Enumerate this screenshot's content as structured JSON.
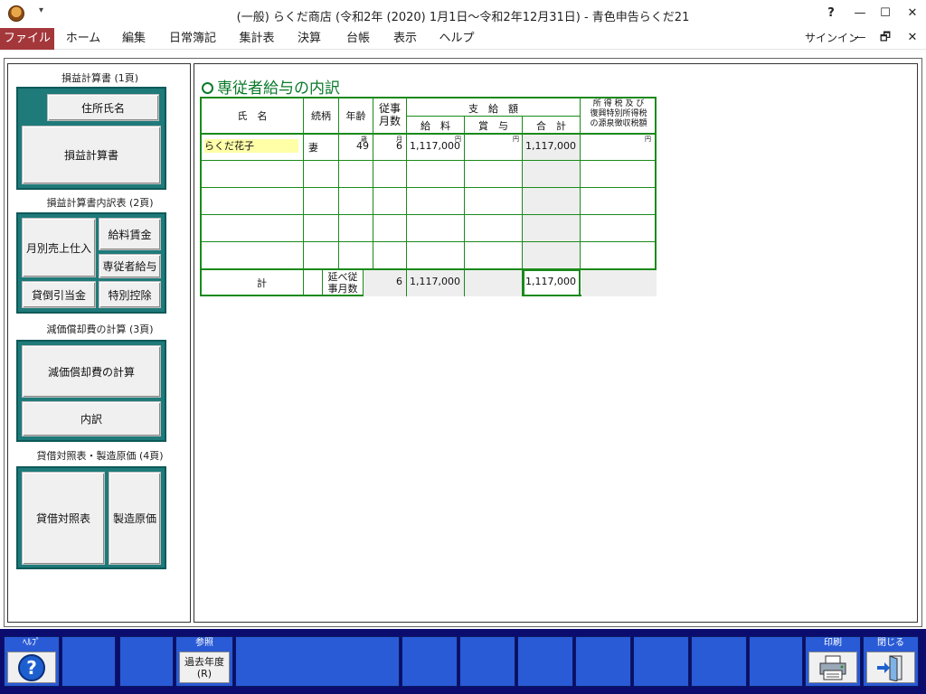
{
  "window": {
    "title": "(一般) らくだ商店 (令和2年 (2020) 1月1日～令和2年12月31日) - 青色申告らくだ21",
    "qat_glyph": "▾",
    "help_glyph": "?",
    "min_glyph": "—",
    "max_glyph": "☐",
    "close_glyph": "✕"
  },
  "ribbon": {
    "tabs": [
      "ファイル",
      "ホーム",
      "編集",
      "日常簿記",
      "集計表",
      "決算",
      "台帳",
      "表示",
      "ヘルプ"
    ],
    "active_tab": "ファイル",
    "signin": "サインイン",
    "restore_glyph": "🗗"
  },
  "nav": {
    "sections": [
      {
        "label": "損益計算書 (1頁)",
        "buttons": [
          "住所氏名",
          "損益計算書"
        ]
      },
      {
        "label": "損益計算書内訳表 (2頁)",
        "buttons": [
          "月別売上仕入",
          "給料賃金",
          "専従者給与",
          "貸倒引当金",
          "特別控除"
        ]
      },
      {
        "label": "減価償却費の計算 (3頁)",
        "buttons": [
          "減価償却費の計算",
          "内訳"
        ]
      },
      {
        "label": "貸借対照表・製造原価 (4頁)",
        "buttons": [
          "貸借対照表",
          "製造原価"
        ]
      }
    ]
  },
  "form": {
    "title": "専従者給与の内訳",
    "headers": {
      "name": "氏　名",
      "relation": "続柄",
      "age": "年齢",
      "months_l1": "従事",
      "months_l2": "月数",
      "paid": "支　給　額",
      "salary": "給　料",
      "bonus": "賞　与",
      "total": "合　計",
      "tax_l1": "所 得 税 及 び",
      "tax_l2": "復興特別所得税",
      "tax_l3": "の源泉徴収税額"
    },
    "unit_age": "歳",
    "unit_month": "月",
    "unit_yen": "円",
    "rows": [
      {
        "name": "らくだ花子",
        "relation": "妻",
        "age": "49",
        "months": "6",
        "salary": "1,117,000",
        "bonus": "",
        "total": "1,117,000",
        "tax": ""
      }
    ],
    "footer": {
      "label": "計",
      "months_l1": "延べ従",
      "months_l2": "事月数",
      "months": "6",
      "salary": "1,117,000",
      "bonus": "",
      "total": "1,117,000",
      "tax": ""
    }
  },
  "fkeys": {
    "help_caption": "ﾍﾙﾌﾟ",
    "help_glyph": "?",
    "ref_caption": "参照",
    "ref_label": "過去年度",
    "ref_key": "(R)",
    "print_caption": "印刷",
    "close_caption": "閉じる"
  },
  "colors": {
    "active_tab": "#a4373a",
    "nav_frame": "#1f7a7a",
    "grid": "#1a8a1a",
    "fbar": "#0c0c6e",
    "fkey": "#2a5bd6"
  }
}
